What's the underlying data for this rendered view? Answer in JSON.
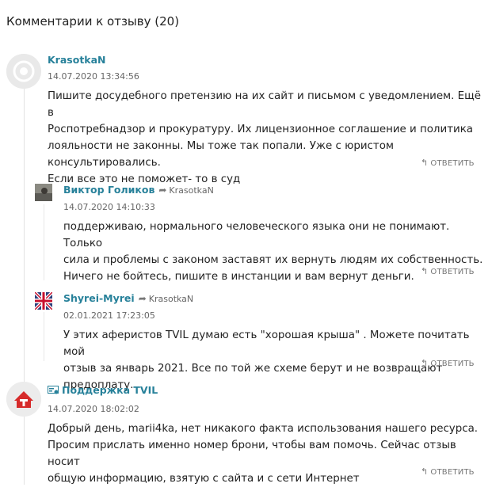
{
  "header": {
    "title": "Комментарии к отзыву (20)"
  },
  "reply_label": "ОТВЕТИТЬ",
  "comments": [
    {
      "author": "KrasotkaN",
      "date": "14.07.2020 13:34:56",
      "lines": [
        "Пишите досудебного претензию на их сайт и письмом с уведомлением. Ещё в",
        "Роспотребнадзор и прокуратуру. Их лицензионное соглашение и политика",
        "лояльности не законны. Мы тоже так попали. Уже с юристом консультировались.",
        "Если все это не поможет- то в суд"
      ]
    },
    {
      "author": "Виктор Голиков",
      "reply_to": "KrasotkaN",
      "date": "14.07.2020 14:10:33",
      "lines": [
        "поддерживаю, нормального человеческого языка они не понимают. Только",
        "сила и проблемы с законом заставят их вернуть людям их собственность.",
        "Ничего не бойтесь, пишите в инстанции и вам вернут деньги."
      ]
    },
    {
      "author": "Shyrei-Myrei",
      "reply_to": "KrasotkaN",
      "date": "02.01.2021 17:23:05",
      "lines": [
        "У этих аферистов TVIL думаю есть \"хорошая крыша\" . Можете почитать мой",
        "отзыв за январь 2021. Все по той же схеме берут и не возвращают предоплату."
      ]
    },
    {
      "author": "Поддержка TVIL",
      "date": "14.07.2020 18:02:02",
      "lines": [
        "Добрый день, marii4ka, нет никакого факта использования нашего ресурса.",
        "Просим прислать именно номер брони, чтобы вам помочь. Сейчас отзыв носит",
        "общую информацию, взятую с сайта и с сети Интернет"
      ]
    }
  ],
  "colors": {
    "author": "#27819a",
    "support_logo": "#d62b2b"
  }
}
